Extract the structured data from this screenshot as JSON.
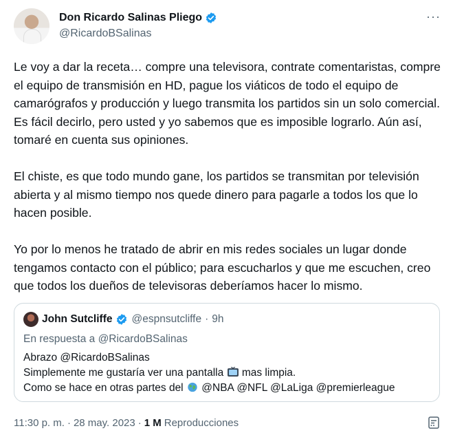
{
  "author": {
    "name": "Don Ricardo Salinas Pliego",
    "handle": "@RicardoBSalinas"
  },
  "more_icon": "···",
  "body": {
    "paragraphs": [
      "Le voy a dar la receta… compre una televisora, contrate comentaristas, compre el equipo de transmisión en HD, pague los viáticos de todo el equipo de camarógrafos y producción y luego transmita los partidos sin un solo comercial. Es fácil decirlo, pero usted y yo sabemos que es imposible lograrlo. Aún así, tomaré en cuenta sus opiniones.",
      "El chiste, es que todo mundo gane, los partidos se transmitan por televisión abierta y al mismo tiempo nos quede dinero para pagarle a todos los que lo hacen posible.",
      "Yo por lo menos he tratado de abrir en mis redes sociales un lugar donde tengamos contacto con el público; para escucharlos y que me escuchen, creo que todos los dueños de televisoras deberíamos hacer lo mismo."
    ]
  },
  "quote": {
    "name": "John Sutcliffe",
    "handle": "@espnsutcliffe",
    "separator": "·",
    "time": "9h",
    "reply_to": "En respuesta a @RicardoBSalinas",
    "line1": "Abrazo @RicardoBSalinas",
    "line2_a": "Simplemente me gustaría ver una pantalla",
    "line2_b": "mas limpia.",
    "line3_a": "Como se hace en otras partes del",
    "line3_b": "@NBA @NFL @LaLiga @premierleague"
  },
  "meta": {
    "time": "11:30 p. m.",
    "dot1": "·",
    "date": "28 may. 2023",
    "dot2": "·",
    "views": "1 M",
    "views_label": "Reproducciones"
  },
  "colors": {
    "verified": "#1d9bf0",
    "secondary_text": "#536471",
    "border": "#cfd9de"
  }
}
